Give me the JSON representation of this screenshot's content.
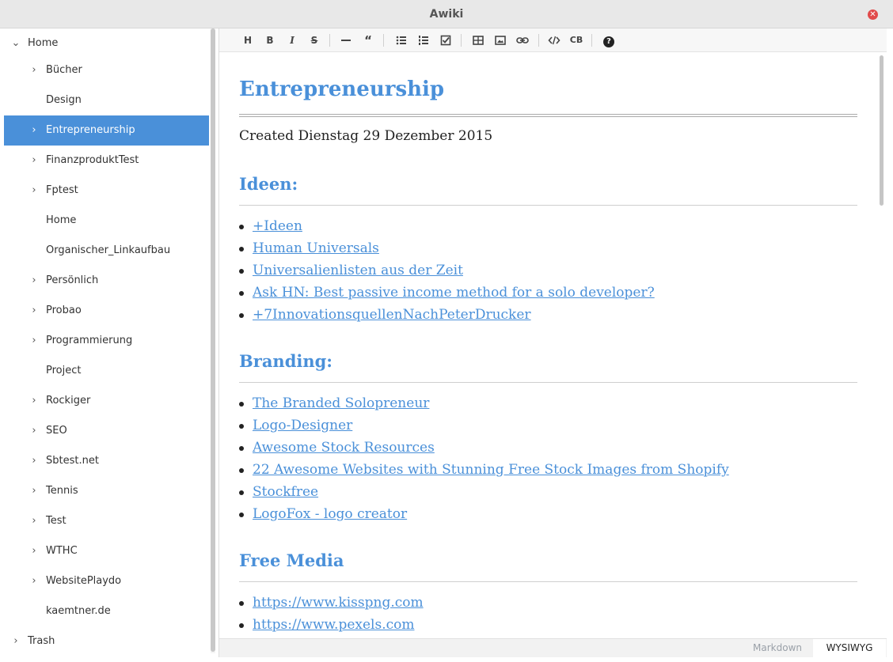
{
  "window": {
    "title": "Awiki",
    "close_icon": "close-icon"
  },
  "sidebar": {
    "items": [
      {
        "label": "Home",
        "expanded": true,
        "has_children": true,
        "level": 0
      },
      {
        "label": "Bücher",
        "has_children": true,
        "level": 1
      },
      {
        "label": "Design",
        "has_children": false,
        "level": 1
      },
      {
        "label": "Entrepreneurship",
        "has_children": true,
        "level": 1,
        "selected": true
      },
      {
        "label": "FinanzproduktTest",
        "has_children": true,
        "level": 1
      },
      {
        "label": "Fptest",
        "has_children": true,
        "level": 1
      },
      {
        "label": "Home",
        "has_children": false,
        "level": 1
      },
      {
        "label": "Organischer_Linkaufbau",
        "has_children": false,
        "level": 1
      },
      {
        "label": "Persönlich",
        "has_children": true,
        "level": 1
      },
      {
        "label": "Probao",
        "has_children": true,
        "level": 1
      },
      {
        "label": "Programmierung",
        "has_children": true,
        "level": 1
      },
      {
        "label": "Project",
        "has_children": false,
        "level": 1
      },
      {
        "label": "Rockiger",
        "has_children": true,
        "level": 1
      },
      {
        "label": "SEO",
        "has_children": true,
        "level": 1
      },
      {
        "label": "Sbtest.net",
        "has_children": true,
        "level": 1
      },
      {
        "label": "Tennis",
        "has_children": true,
        "level": 1
      },
      {
        "label": "Test",
        "has_children": true,
        "level": 1
      },
      {
        "label": "WTHC",
        "has_children": true,
        "level": 1
      },
      {
        "label": "WebsitePlaydo",
        "has_children": true,
        "level": 1
      },
      {
        "label": "kaemtner.de",
        "has_children": false,
        "level": 1
      },
      {
        "label": "Trash",
        "has_children": true,
        "level": 0
      }
    ],
    "selected_color": "#4a90d9"
  },
  "toolbar": {
    "heading_label": "H",
    "bold_label": "B",
    "italic_label": "I",
    "strike_label": "S",
    "quote_label": "“",
    "codeblock_label": "CB",
    "help_label": "?"
  },
  "document": {
    "title": "Entrepreneurship",
    "created": "Created Dienstag 29 Dezember 2015",
    "sections": [
      {
        "heading": "Ideen:",
        "links": [
          "+Ideen",
          "Human Universals",
          "Universalienlisten aus der Zeit",
          "Ask HN: Best passive income method for a solo developer?",
          "+7InnovationsquellenNachPeterDrucker"
        ]
      },
      {
        "heading": "Branding:",
        "links": [
          "The Branded Solopreneur",
          "Logo-Designer",
          "Awesome Stock Resources",
          "22 Awesome Websites with Stunning Free Stock Images from Shopify",
          "Stockfree",
          "LogoFox - logo creator"
        ]
      },
      {
        "heading": "Free Media",
        "links": [
          "https://www.kisspng.com",
          "https://www.pexels.com"
        ]
      }
    ],
    "accent_color": "#4a90d9"
  },
  "mode_bar": {
    "markdown_label": "Markdown",
    "wysiwyg_label": "WYSIWYG",
    "active": "WYSIWYG"
  }
}
